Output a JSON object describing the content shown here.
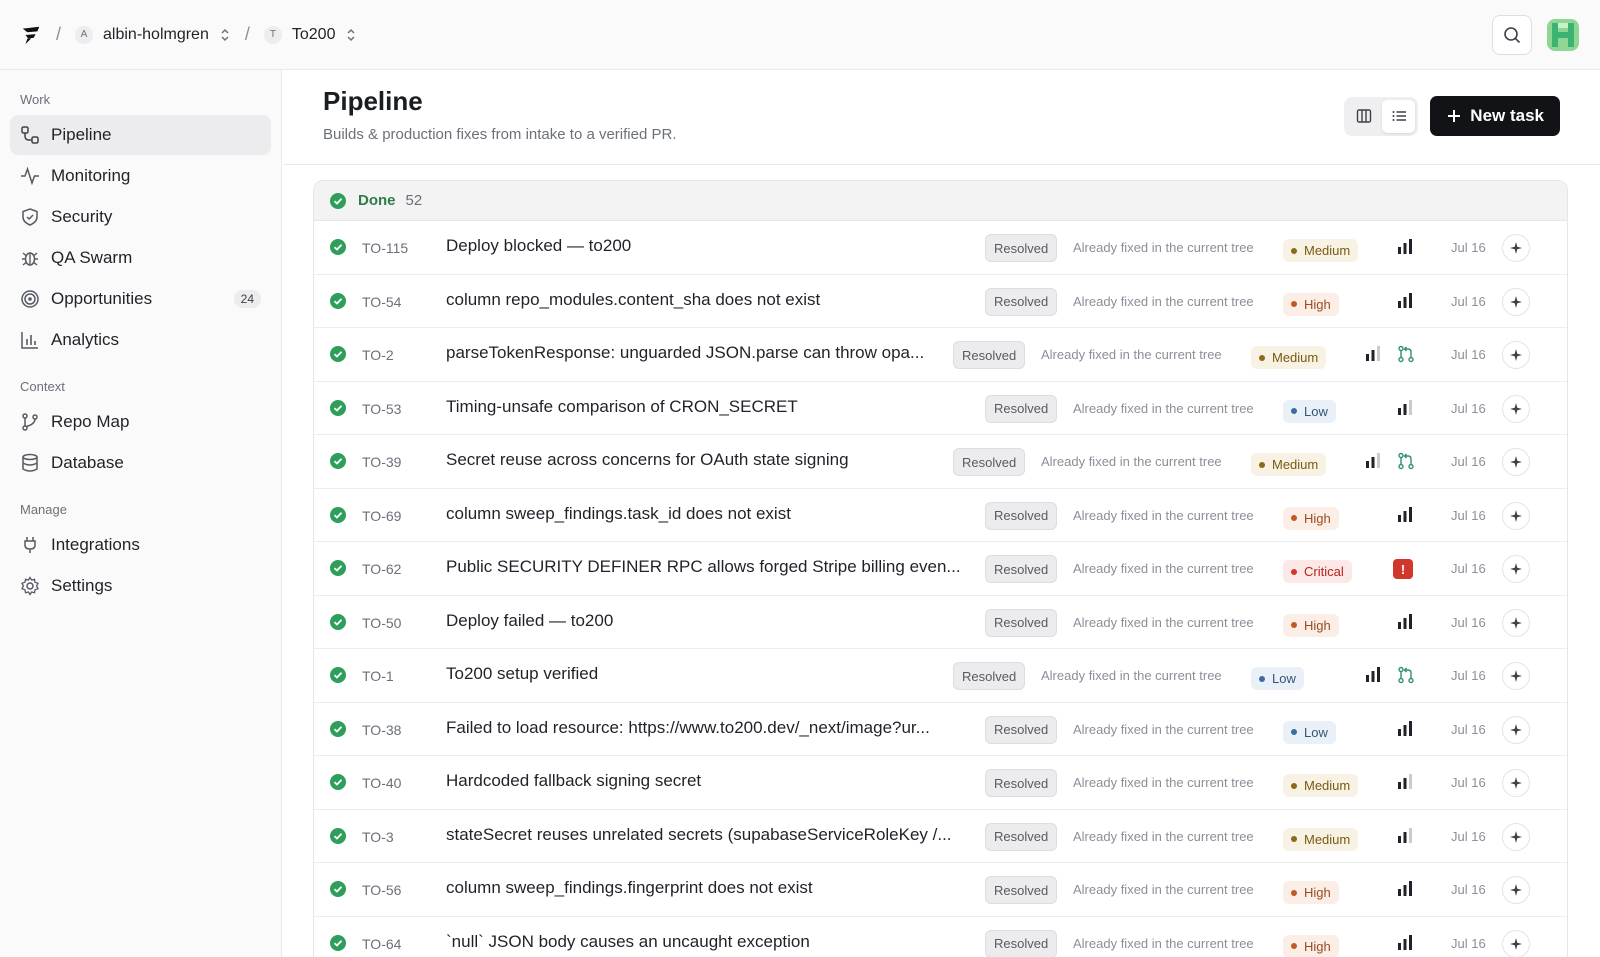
{
  "breadcrumb": {
    "org": {
      "initial": "A",
      "label": "albin-holmgren"
    },
    "project": {
      "initial": "T",
      "label": "To200"
    }
  },
  "sidebar": {
    "sections": [
      {
        "title": "Work",
        "items": [
          {
            "label": "Pipeline",
            "icon": "pipeline-icon",
            "active": true
          },
          {
            "label": "Monitoring",
            "icon": "activity-icon"
          },
          {
            "label": "Security",
            "icon": "shield-icon"
          },
          {
            "label": "QA Swarm",
            "icon": "bug-icon"
          },
          {
            "label": "Opportunities",
            "icon": "target-icon",
            "badge": "24"
          },
          {
            "label": "Analytics",
            "icon": "bar-chart-icon"
          }
        ]
      },
      {
        "title": "Context",
        "items": [
          {
            "label": "Repo Map",
            "icon": "git-branch-icon"
          },
          {
            "label": "Database",
            "icon": "database-icon"
          }
        ]
      },
      {
        "title": "Manage",
        "items": [
          {
            "label": "Integrations",
            "icon": "plug-icon"
          },
          {
            "label": "Settings",
            "icon": "gear-icon"
          }
        ]
      }
    ]
  },
  "page": {
    "title": "Pipeline",
    "subtitle": "Builds & production fixes from intake to a verified PR.",
    "new_task_label": "New task"
  },
  "group": {
    "label": "Done",
    "count": "52"
  },
  "colors": {
    "done_green": "#2f9e5b",
    "critical_red": "#d2372b"
  },
  "tasks": [
    {
      "id": "TO-115",
      "title": "Deploy blocked — to200",
      "status": "Resolved",
      "note": "Already fixed in the current tree",
      "priority": "Medium",
      "signal": "full",
      "pr": false,
      "date": "Jul 16"
    },
    {
      "id": "TO-54",
      "title": "column repo_modules.content_sha does not exist",
      "status": "Resolved",
      "note": "Already fixed in the current tree",
      "priority": "High",
      "signal": "full",
      "pr": false,
      "date": "Jul 16"
    },
    {
      "id": "TO-2",
      "title": "parseTokenResponse: unguarded JSON.parse can throw opa...",
      "status": "Resolved",
      "note": "Already fixed in the current tree",
      "priority": "Medium",
      "signal": "two",
      "pr": true,
      "date": "Jul 16"
    },
    {
      "id": "TO-53",
      "title": "Timing-unsafe comparison of CRON_SECRET",
      "status": "Resolved",
      "note": "Already fixed in the current tree",
      "priority": "Low",
      "signal": "two",
      "pr": false,
      "date": "Jul 16"
    },
    {
      "id": "TO-39",
      "title": "Secret reuse across concerns for OAuth state signing",
      "status": "Resolved",
      "note": "Already fixed in the current tree",
      "priority": "Medium",
      "signal": "two",
      "pr": true,
      "date": "Jul 16"
    },
    {
      "id": "TO-69",
      "title": "column sweep_findings.task_id does not exist",
      "status": "Resolved",
      "note": "Already fixed in the current tree",
      "priority": "High",
      "signal": "full",
      "pr": false,
      "date": "Jul 16"
    },
    {
      "id": "TO-62",
      "title": "Public SECURITY DEFINER RPC allows forged Stripe billing even...",
      "status": "Resolved",
      "note": "Already fixed in the current tree",
      "priority": "Critical",
      "signal": "critical",
      "pr": false,
      "date": "Jul 16"
    },
    {
      "id": "TO-50",
      "title": "Deploy failed — to200",
      "status": "Resolved",
      "note": "Already fixed in the current tree",
      "priority": "High",
      "signal": "full",
      "pr": false,
      "date": "Jul 16"
    },
    {
      "id": "TO-1",
      "title": "To200 setup verified",
      "status": "Resolved",
      "note": "Already fixed in the current tree",
      "priority": "Low",
      "signal": "full",
      "pr": true,
      "date": "Jul 16"
    },
    {
      "id": "TO-38",
      "title": "Failed to load resource: https://www.to200.dev/_next/image?ur...",
      "status": "Resolved",
      "note": "Already fixed in the current tree",
      "priority": "Low",
      "signal": "full",
      "pr": false,
      "date": "Jul 16"
    },
    {
      "id": "TO-40",
      "title": "Hardcoded fallback signing secret",
      "status": "Resolved",
      "note": "Already fixed in the current tree",
      "priority": "Medium",
      "signal": "two",
      "pr": false,
      "date": "Jul 16"
    },
    {
      "id": "TO-3",
      "title": "stateSecret reuses unrelated secrets (supabaseServiceRoleKey /...",
      "status": "Resolved",
      "note": "Already fixed in the current tree",
      "priority": "Medium",
      "signal": "two",
      "pr": false,
      "date": "Jul 16"
    },
    {
      "id": "TO-56",
      "title": "column sweep_findings.fingerprint does not exist",
      "status": "Resolved",
      "note": "Already fixed in the current tree",
      "priority": "High",
      "signal": "full",
      "pr": false,
      "date": "Jul 16"
    },
    {
      "id": "TO-64",
      "title": "`null` JSON body causes an uncaught exception",
      "status": "Resolved",
      "note": "Already fixed in the current tree",
      "priority": "High",
      "signal": "full",
      "pr": false,
      "date": "Jul 16"
    }
  ]
}
